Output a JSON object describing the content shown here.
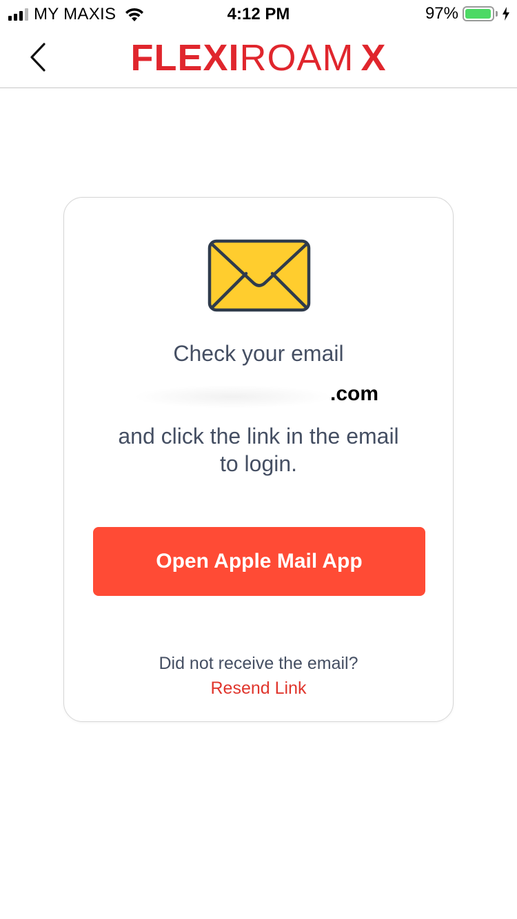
{
  "status_bar": {
    "carrier": "MY MAXIS",
    "time": "4:12 PM",
    "battery_percent_label": "97%",
    "battery_level": 0.97,
    "charging": true,
    "signal_bars": 3,
    "icons": [
      "signal-icon",
      "wifi-icon",
      "battery-icon",
      "charging-bolt-icon"
    ]
  },
  "nav_bar": {
    "back_icon": "chevron-left-icon",
    "logo": {
      "part1": "FLEXI",
      "part2": "ROAM",
      "part3": "X"
    }
  },
  "card": {
    "icon": "envelope-icon",
    "heading": "Check your email",
    "email_domain": ".com",
    "instruction_line1": "and click the link in the email",
    "instruction_line2": "to login.",
    "open_mail_button": "Open Apple Mail App",
    "not_received_text": "Did not receive the email?",
    "resend_link": "Resend Link"
  },
  "colors": {
    "brand_red": "#e0262d",
    "button_orange": "#ff4b35",
    "text_slate": "#454f63",
    "envelope_yellow": "#ffcd2e",
    "envelope_outline": "#2f3b4c",
    "battery_green": "#4cd964"
  }
}
